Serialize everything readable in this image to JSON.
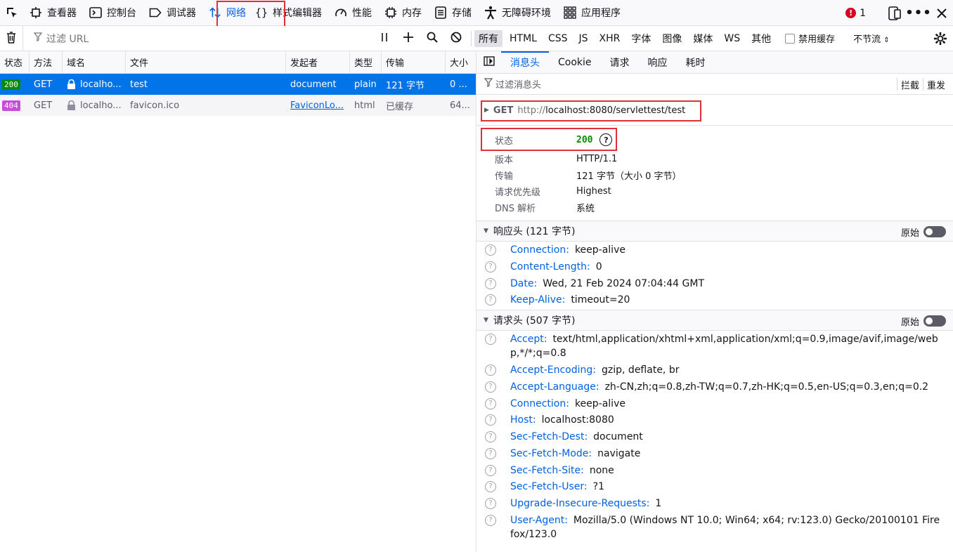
{
  "toolbar": {
    "tabs": [
      {
        "label": "查看器",
        "icon": "inspector-icon"
      },
      {
        "label": "控制台",
        "icon": "console-icon"
      },
      {
        "label": "调试器",
        "icon": "debugger-icon"
      },
      {
        "label": "网络",
        "icon": "network-icon"
      },
      {
        "label": "样式编辑器",
        "icon": "style-editor-icon"
      },
      {
        "label": "性能",
        "icon": "performance-icon"
      },
      {
        "label": "内存",
        "icon": "memory-icon"
      },
      {
        "label": "存储",
        "icon": "storage-icon"
      },
      {
        "label": "无障碍环境",
        "icon": "accessibility-icon"
      },
      {
        "label": "应用程序",
        "icon": "application-icon"
      }
    ],
    "active_tab": "网络",
    "error_count": "1"
  },
  "filterbar": {
    "url_placeholder": "过滤 URL",
    "types": [
      "所有",
      "HTML",
      "CSS",
      "JS",
      "XHR",
      "字体",
      "图像",
      "媒体",
      "WS",
      "其他"
    ],
    "disable_cache": "禁用缓存",
    "throttle": "不节流"
  },
  "requests": {
    "columns": [
      "状态",
      "方法",
      "域名",
      "文件",
      "发起者",
      "类型",
      "传输",
      "大小"
    ],
    "rows": [
      {
        "status": "200",
        "method": "GET",
        "domain": "localho...",
        "file": "test",
        "initiator": "document",
        "type": "plain",
        "transfer": "121 字节",
        "size": "0 ..."
      },
      {
        "status": "404",
        "method": "GET",
        "domain": "localho...",
        "file": "favicon.ico",
        "initiator": "FaviconLo...",
        "type": "html",
        "transfer": "已缓存",
        "size": "64..."
      }
    ]
  },
  "details": {
    "tabs": [
      "消息头",
      "Cookie",
      "请求",
      "响应",
      "耗时"
    ],
    "filter_placeholder": "过滤消息头",
    "block_label": "拦截",
    "resend_label": "重发",
    "method": "GET",
    "url_prefix": "http://",
    "url_path": "localhost:8080/servlettest/test",
    "summary": [
      {
        "key": "状态",
        "value": "200"
      },
      {
        "key": "版本",
        "value": "HTTP/1.1"
      },
      {
        "key": "传输",
        "value": "121 字节（大小 0 字节）"
      },
      {
        "key": "请求优先级",
        "value": "Highest"
      },
      {
        "key": "DNS 解析",
        "value": "系统"
      }
    ],
    "raw_label": "原始",
    "response_headers_title": "响应头 (121 字节)",
    "response_headers": [
      {
        "name": "Connection:",
        "value": "keep-alive"
      },
      {
        "name": "Content-Length:",
        "value": "0"
      },
      {
        "name": "Date:",
        "value": "Wed, 21 Feb 2024 07:04:44 GMT"
      },
      {
        "name": "Keep-Alive:",
        "value": "timeout=20"
      }
    ],
    "request_headers_title": "请求头 (507 字节)",
    "request_headers": [
      {
        "name": "Accept:",
        "value": "text/html,application/xhtml+xml,application/xml;q=0.9,image/avif,image/webp,*/*;q=0.8"
      },
      {
        "name": "Accept-Encoding:",
        "value": "gzip, deflate, br"
      },
      {
        "name": "Accept-Language:",
        "value": "zh-CN,zh;q=0.8,zh-TW;q=0.7,zh-HK;q=0.5,en-US;q=0.3,en;q=0.2"
      },
      {
        "name": "Connection:",
        "value": "keep-alive"
      },
      {
        "name": "Host:",
        "value": "localhost:8080"
      },
      {
        "name": "Sec-Fetch-Dest:",
        "value": "document"
      },
      {
        "name": "Sec-Fetch-Mode:",
        "value": "navigate"
      },
      {
        "name": "Sec-Fetch-Site:",
        "value": "none"
      },
      {
        "name": "Sec-Fetch-User:",
        "value": "?1"
      },
      {
        "name": "Upgrade-Insecure-Requests:",
        "value": "1"
      },
      {
        "name": "User-Agent:",
        "value": "Mozilla/5.0 (Windows NT 10.0; Win64; x64; rv:123.0) Gecko/20100101 Firefox/123.0"
      }
    ]
  },
  "colors": {
    "accent": "#0061e0",
    "selected_row": "#0074e8",
    "status_200": "#058b00",
    "status_404": "#c94bda",
    "highlight_box": "#e0303a"
  }
}
